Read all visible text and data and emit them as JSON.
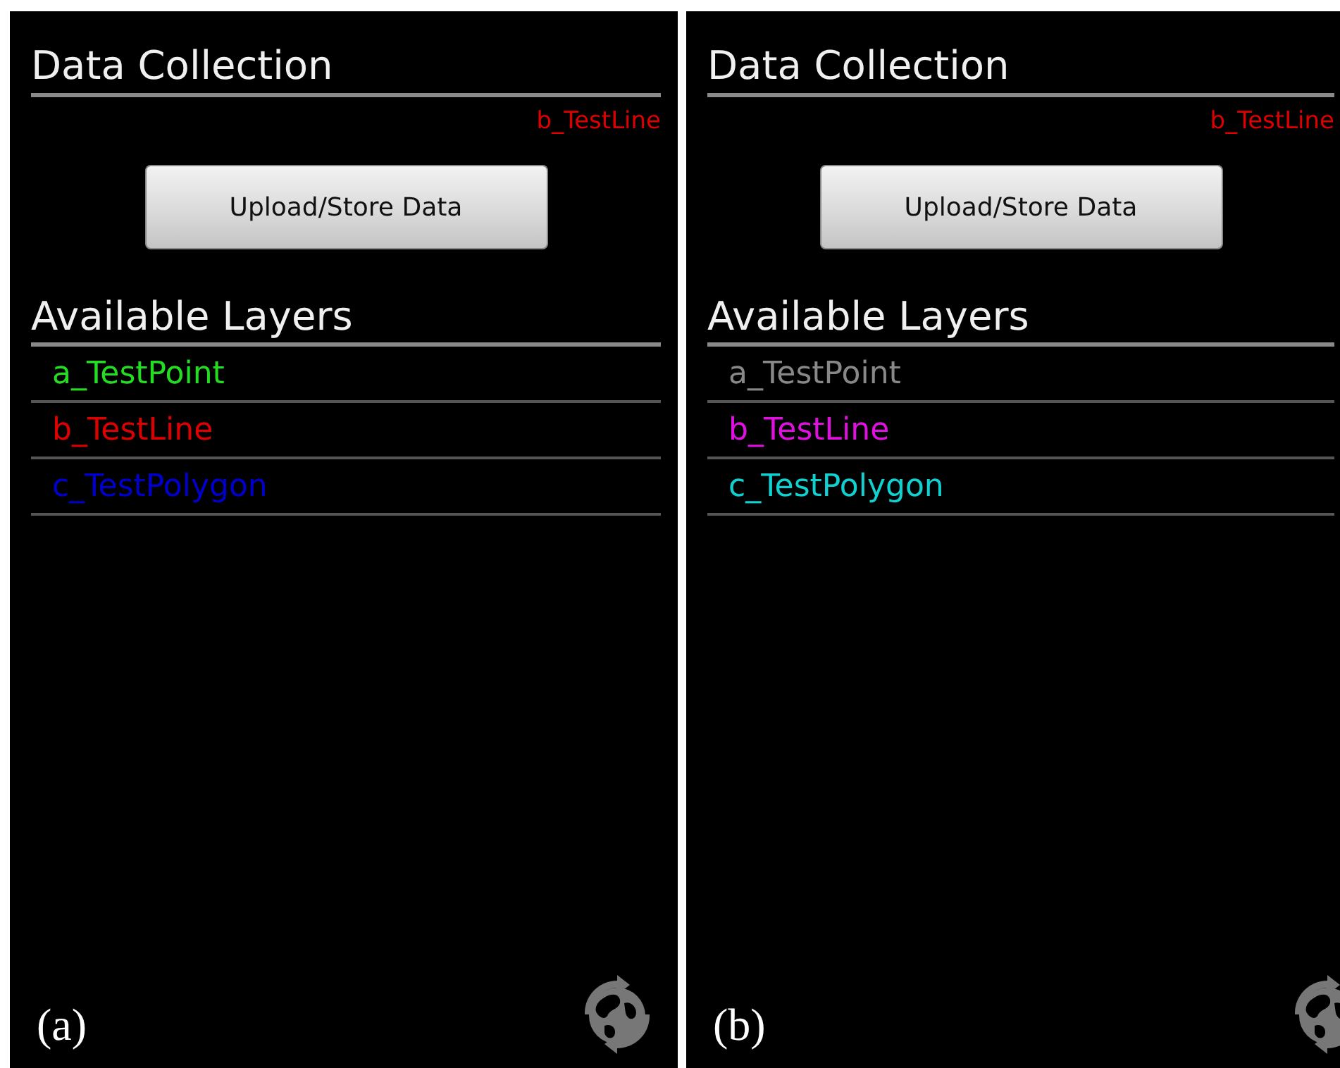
{
  "panels": [
    {
      "caption": "(a)",
      "title": "Data Collection",
      "selected_layer": {
        "label": "b_TestLine",
        "color": "#dd0000"
      },
      "button": "Upload/Store Data",
      "section_title": "Available Layers",
      "layers": [
        {
          "label": "a_TestPoint",
          "color": "#22dd22"
        },
        {
          "label": "b_TestLine",
          "color": "#dd0000"
        },
        {
          "label": "c_TestPolygon",
          "color": "#0000cc"
        }
      ]
    },
    {
      "caption": "(b)",
      "title": "Data Collection",
      "selected_layer": {
        "label": "b_TestLine",
        "color": "#dd0000"
      },
      "button": "Upload/Store Data",
      "section_title": "Available Layers",
      "layers": [
        {
          "label": "a_TestPoint",
          "color": "#888888"
        },
        {
          "label": "b_TestLine",
          "color": "#e010e0"
        },
        {
          "label": "c_TestPolygon",
          "color": "#10d0d0"
        }
      ]
    }
  ]
}
